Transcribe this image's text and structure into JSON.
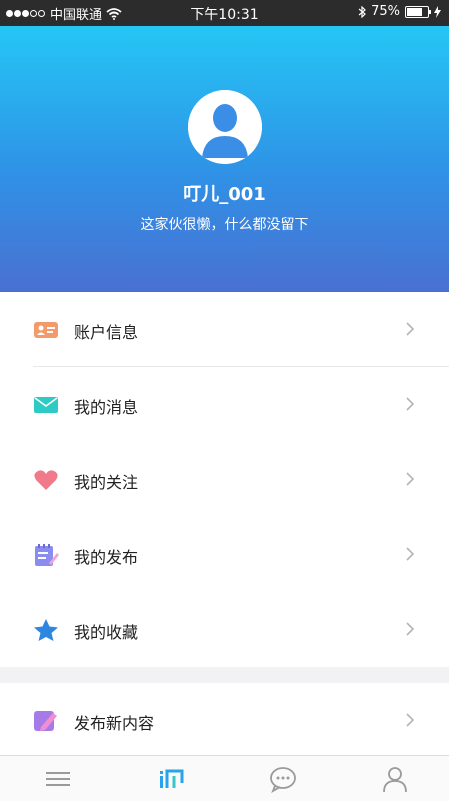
{
  "status_bar": {
    "carrier": "中国联通",
    "time": "下午10:31",
    "battery": "75%",
    "battery_level": 0.75
  },
  "profile": {
    "username": "叮儿_001",
    "signature": "这家伙很懒，什么都没留下"
  },
  "menu": [
    {
      "label": "账户信息",
      "icon": "id-card-icon"
    },
    {
      "label": "我的消息",
      "icon": "envelope-icon"
    },
    {
      "label": "我的关注",
      "icon": "heart-icon"
    },
    {
      "label": "我的发布",
      "icon": "notepad-icon"
    },
    {
      "label": "我的收藏",
      "icon": "star-icon"
    }
  ],
  "menu2": [
    {
      "label": "发布新内容",
      "icon": "pencil-icon"
    }
  ],
  "tabbar": {
    "tabs": [
      "menu-icon",
      "home-logo-icon",
      "chat-icon",
      "profile-icon"
    ]
  },
  "colors": {
    "header_top": "#25c6f5",
    "header_bottom": "#4a70d2",
    "accent": "#2aa3ef"
  }
}
